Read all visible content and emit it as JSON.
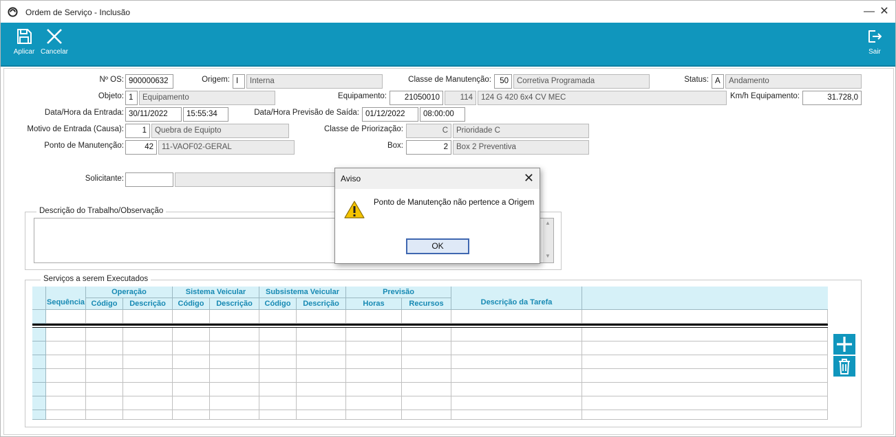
{
  "window": {
    "title": "Ordem de Serviço - Inclusão",
    "minimize_glyph": "—",
    "close_glyph": "✕"
  },
  "toolbar": {
    "apply_label": "Aplicar",
    "cancel_label": "Cancelar",
    "exit_label": "Sair",
    "color": "#1096bd"
  },
  "form": {
    "os_label": "Nº OS:",
    "os_value": "900000632",
    "origem_label": "Origem:",
    "origem_code": "I",
    "origem_desc": "Interna",
    "classe_label": "Classe de Manutenção:",
    "classe_code": "50",
    "classe_desc": "Corretiva Programada",
    "status_label": "Status:",
    "status_code": "A",
    "status_desc": "Andamento",
    "objeto_label": "Objeto:",
    "objeto_code": "1",
    "objeto_desc": "Equipamento",
    "equip_label": "Equipamento:",
    "equip_code": "21050010",
    "equip_num": "114",
    "equip_desc": "124 G 420 6x4 CV MEC",
    "kmh_label": "Km/h Equipamento:",
    "kmh_value": "31.728,0",
    "entrada_label": "Data/Hora da Entrada:",
    "entrada_date": "30/11/2022",
    "entrada_time": "15:55:34",
    "saida_label": "Data/Hora Previsão de Saída:",
    "saida_date": "01/12/2022",
    "saida_time": "08:00:00",
    "motivo_label": "Motivo de Entrada (Causa):",
    "motivo_code": "1",
    "motivo_desc": "Quebra de Equipto",
    "prior_label": "Classe de Priorização:",
    "prior_code": "C",
    "prior_desc": "Prioridade C",
    "ponto_label": "Ponto de Manutenção:",
    "ponto_code": "42",
    "ponto_desc": "11-VAOF02-GERAL",
    "box_label": "Box:",
    "box_code": "2",
    "box_desc": "Box 2 Preventiva",
    "solic_label": "Solicitante:",
    "solic_code": "",
    "solic_desc": ""
  },
  "descricao": {
    "title": "Descrição do Trabalho/Observação",
    "text": ""
  },
  "servicos": {
    "title": "Serviços a serem Executados",
    "groups": [
      "Operação",
      "Sistema Veicular",
      "Subsistema Veicular",
      "Previsão"
    ],
    "columns": [
      "Sequência",
      "Código",
      "Descrição",
      "Código",
      "Descrição",
      "Código",
      "Descrição",
      "Horas",
      "Recursos",
      "Descrição da Tarefa"
    ]
  },
  "dialog": {
    "title": "Aviso",
    "message": "Ponto de Manutenção não pertence a Origem",
    "ok_label": "OK",
    "close_glyph": "✕"
  }
}
